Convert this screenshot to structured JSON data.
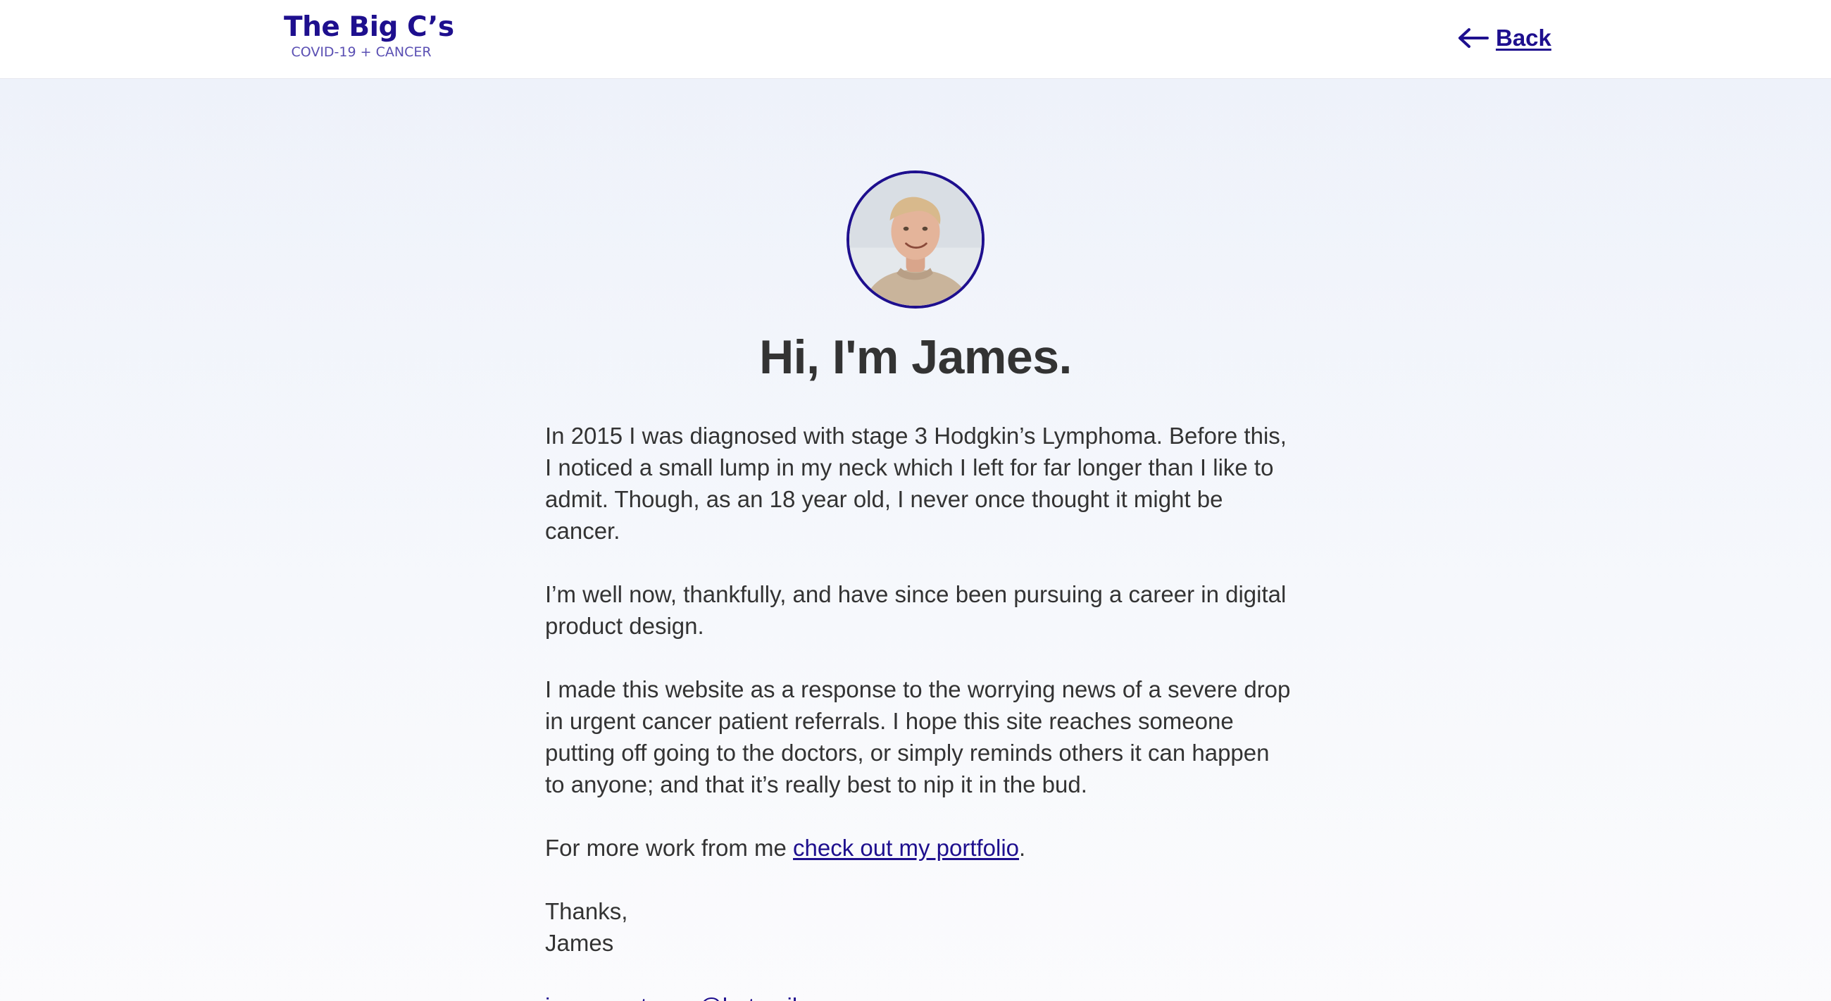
{
  "header": {
    "logo_title": "The Big C’s",
    "logo_subtitle": "COVID-19 + CANCER",
    "back_label": "Back",
    "back_icon": "arrow-left-icon"
  },
  "profile": {
    "avatar_icon": "profile-photo",
    "heading": "Hi, I'm James."
  },
  "body": {
    "paragraph_1": "In 2015 I was diagnosed with stage 3 Hodgkin’s Lymphoma. Before this, I noticed a small lump in my neck which I left for far longer than I like to admit. Though, as an 18 year old, I never once thought it might be cancer.",
    "paragraph_2": "I’m well now, thankfully, and have since been pursuing a career in digital product design.",
    "paragraph_3": "I made this website as a response to the worrying news of a severe drop in urgent cancer patient referrals. I hope this site reaches someone putting off going to the doctors, or simply reminds others it can happen to anyone; and that it’s really best to nip it in the bud.",
    "portfolio_prefix": "For more work from me ",
    "portfolio_link": "check out my portfolio",
    "portfolio_suffix": ".",
    "signoff": "Thanks,",
    "signature": "James",
    "email": "jamesnorton__@hotmail.com"
  },
  "colors": {
    "accent": "#1e0f8e",
    "text": "#333333",
    "background": "#f3f5fb"
  }
}
